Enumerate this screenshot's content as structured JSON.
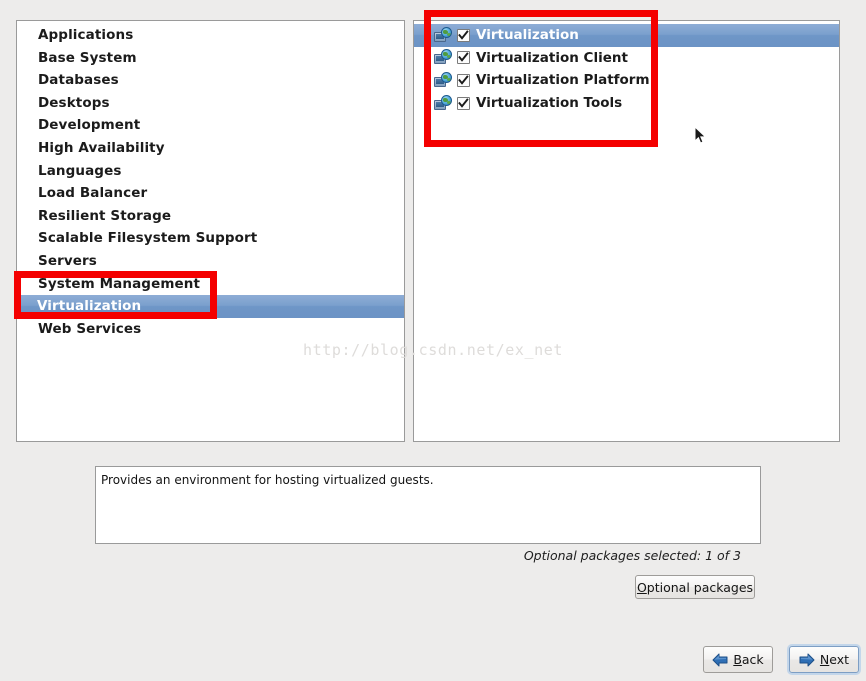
{
  "group_panel": {
    "name": "package-group-list",
    "items": [
      {
        "label": "Applications",
        "selected": false
      },
      {
        "label": "Base System",
        "selected": false
      },
      {
        "label": "Databases",
        "selected": false
      },
      {
        "label": "Desktops",
        "selected": false
      },
      {
        "label": "Development",
        "selected": false
      },
      {
        "label": "High Availability",
        "selected": false
      },
      {
        "label": "Languages",
        "selected": false
      },
      {
        "label": "Load Balancer",
        "selected": false
      },
      {
        "label": "Resilient Storage",
        "selected": false
      },
      {
        "label": "Scalable Filesystem Support",
        "selected": false
      },
      {
        "label": "Servers",
        "selected": false
      },
      {
        "label": "System Management",
        "selected": false
      },
      {
        "label": "Virtualization",
        "selected": true
      },
      {
        "label": "Web Services",
        "selected": false
      }
    ]
  },
  "package_panel": {
    "name": "package-list",
    "items": [
      {
        "label": "Virtualization",
        "checked": true,
        "selected": true
      },
      {
        "label": "Virtualization Client",
        "checked": true,
        "selected": false
      },
      {
        "label": "Virtualization Platform",
        "checked": true,
        "selected": false
      },
      {
        "label": "Virtualization Tools",
        "checked": true,
        "selected": false
      }
    ]
  },
  "description": {
    "text": "Provides an environment for hosting virtualized guests."
  },
  "optional_count": {
    "text": "Optional packages selected: 1 of 3"
  },
  "buttons": {
    "optional_packages": {
      "prefix": "",
      "mnemonic": "O",
      "suffix": "ptional packages"
    },
    "back": {
      "prefix": "",
      "mnemonic": "B",
      "suffix": "ack",
      "icon": "arrow-left-icon"
    },
    "next": {
      "prefix": "",
      "mnemonic": "N",
      "suffix": "ext",
      "icon": "arrow-right-icon"
    }
  },
  "watermark": {
    "text": "http://blog.csdn.net/ex_net"
  },
  "colors": {
    "selection_blue": "#7ba0cd",
    "annotation_red": "#f40000",
    "window_background": "#edeceb",
    "panel_background": "#ffffff"
  }
}
